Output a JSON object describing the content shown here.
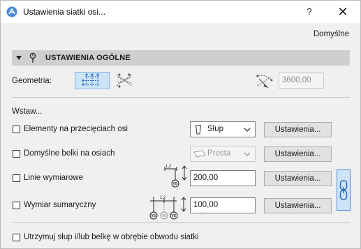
{
  "window": {
    "title": "Ustawienia siatki osi...",
    "help_label": "?",
    "close_label": "✕"
  },
  "header": {
    "defaults_link": "Domyślne"
  },
  "section": {
    "title": "USTAWIENIA OGÓLNE"
  },
  "geometry": {
    "label": "Geometria:",
    "value": "3600,00"
  },
  "insert": {
    "heading": "Wstaw...",
    "column_label": "Elementy na przecięciach osi",
    "column_select": "Słup",
    "beam_label": "Domyślne belki na osiach",
    "beam_select": "Prosta",
    "dim_label": "Linie wymiarowe",
    "dim_value": "200,00",
    "sum_label": "Wymiar sumaryczny",
    "sum_value": "100,00",
    "settings_label": "Ustawienia..."
  },
  "footer": {
    "keep_label": "Utrzymuj słup i/lub belkę w obrębie obwodu siatki"
  },
  "diagram": {
    "dim_text": "1,2",
    "tag_text": "Y5"
  },
  "colors": {
    "accent": "#3f7fd0",
    "header_bg": "#cfcfcf"
  }
}
